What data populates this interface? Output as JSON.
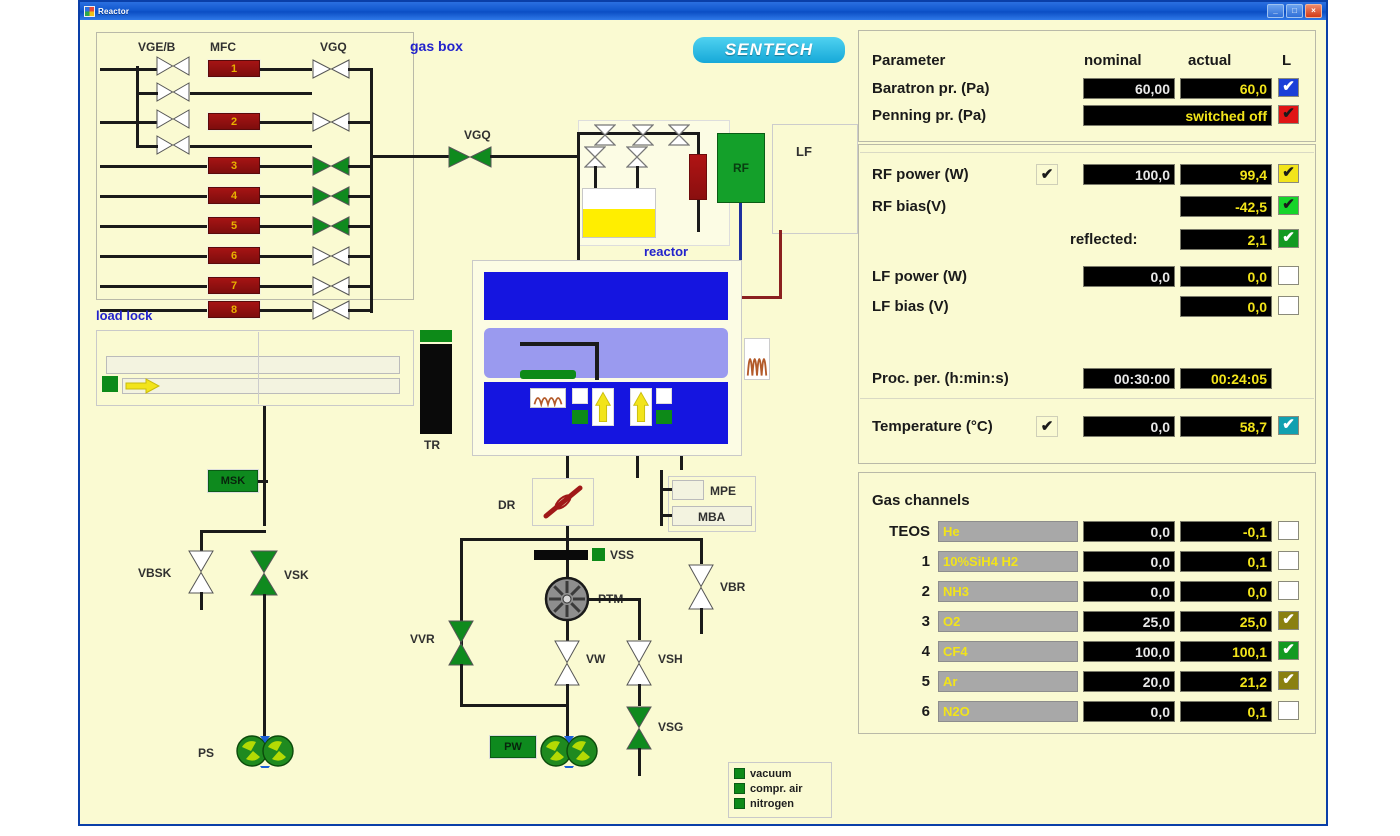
{
  "window": {
    "title": "Reactor",
    "minimize": "_",
    "maximize": "□",
    "close": "×"
  },
  "brand": {
    "logo": "SENTECH"
  },
  "diagram": {
    "gas_box_label": "gas box",
    "reactor_label": "reactor",
    "load_lock_label": "load lock",
    "column_headers": {
      "vge": "VGE/B",
      "mfc": "MFC",
      "vgq": "VGQ"
    },
    "mfc_channels": [
      "1",
      "2",
      "3",
      "4",
      "5",
      "6",
      "7",
      "8"
    ],
    "vgq_inline_label": "VGQ",
    "rf_generator": "RF",
    "lf_generator": "LF",
    "transfer": "TR",
    "msk": "MSK",
    "vbsk": "VBSK",
    "vsk": "VSK",
    "ps_pump": "PS",
    "dr_valve": "DR",
    "vss": "VSS",
    "ptm": "PTM",
    "vbr": "VBR",
    "vvr": "VVR",
    "vw": "VW",
    "vsh": "VSH",
    "vsg": "VSG",
    "pw_pump": "PW",
    "mpe": "MPE",
    "mba": "MBA",
    "legend": [
      {
        "label": "vacuum",
        "color": "#0d8a18"
      },
      {
        "label": "compr. air",
        "color": "#0d8a18"
      },
      {
        "label": "nitrogen",
        "color": "#0d8a18"
      }
    ]
  },
  "parameters": {
    "headers": {
      "name": "Parameter",
      "nominal": "nominal",
      "actual": "actual",
      "lock": "L"
    },
    "rows": [
      {
        "label": "Baratron pr. (Pa)",
        "nominal": "60,00",
        "actual": "60,0",
        "checkbox": "checked",
        "checkbox_color": "#1a3fd8",
        "tick_color": "#ffffff",
        "has_pre_check": false
      },
      {
        "label": "Penning pr. (Pa)",
        "nominal": "",
        "actual": "switched off",
        "checkbox": "checked",
        "checkbox_color": "#e01414",
        "tick_color": "#1a1a1a",
        "has_pre_check": false
      }
    ]
  },
  "power": {
    "reflected_label": "reflected:",
    "rows": [
      {
        "label": "RF power (W)",
        "nominal": "100,0",
        "actual": "99,4",
        "checkbox": "checked",
        "checkbox_color": "#f2e41a",
        "tick_color": "#1a1a1a",
        "has_pre_check": true
      },
      {
        "label": "RF bias(V)",
        "nominal": "",
        "actual": "-42,5",
        "checkbox": "checked",
        "checkbox_color": "#16d42a",
        "tick_color": "#1a1a1a",
        "has_pre_check": false
      },
      {
        "label": "",
        "nominal": "reflected:",
        "actual": "2,1",
        "checkbox": "checked",
        "checkbox_color": "#139a22",
        "tick_color": "#ffffff",
        "has_pre_check": false
      },
      {
        "label": "LF power (W)",
        "nominal": "0,0",
        "actual": "0,0",
        "checkbox": "unchecked",
        "checkbox_color": "#ffffff",
        "tick_color": "#ffffff",
        "has_pre_check": false
      },
      {
        "label": "LF bias (V)",
        "nominal": "",
        "actual": "0,0",
        "checkbox": "unchecked",
        "checkbox_color": "#ffffff",
        "tick_color": "#ffffff",
        "has_pre_check": false
      }
    ]
  },
  "process": {
    "period": {
      "label": "Proc. per. (h:min:s)",
      "nominal": "00:30:00",
      "actual": "00:24:05"
    },
    "temperature": {
      "label": "Temperature (°C)",
      "nominal": "0,0",
      "actual": "58,7",
      "checkbox": "checked",
      "checkbox_color": "#11a0b0",
      "tick_color": "#ffffff",
      "has_pre_check": true
    }
  },
  "gas": {
    "title": "Gas channels",
    "rows": [
      {
        "channel": "TEOS",
        "name": "He",
        "nominal": "0,0",
        "actual": "-0,1",
        "checkbox": "unchecked",
        "checkbox_color": "#ffffff",
        "tick_color": "#ffffff"
      },
      {
        "channel": "1",
        "name": "10%SiH4 H2",
        "nominal": "0,0",
        "actual": "0,1",
        "checkbox": "unchecked",
        "checkbox_color": "#ffffff",
        "tick_color": "#ffffff"
      },
      {
        "channel": "2",
        "name": "NH3",
        "nominal": "0,0",
        "actual": "0,0",
        "checkbox": "unchecked",
        "checkbox_color": "#ffffff",
        "tick_color": "#ffffff"
      },
      {
        "channel": "3",
        "name": "O2",
        "nominal": "25,0",
        "actual": "25,0",
        "checkbox": "checked",
        "checkbox_color": "#8a8010",
        "tick_color": "#ffffff"
      },
      {
        "channel": "4",
        "name": "CF4",
        "nominal": "100,0",
        "actual": "100,1",
        "checkbox": "checked",
        "checkbox_color": "#139a22",
        "tick_color": "#ffffff"
      },
      {
        "channel": "5",
        "name": "Ar",
        "nominal": "20,0",
        "actual": "21,2",
        "checkbox": "checked",
        "checkbox_color": "#8a8010",
        "tick_color": "#ffffff"
      },
      {
        "channel": "6",
        "name": "N2O",
        "nominal": "0,0",
        "actual": "0,1",
        "checkbox": "unchecked",
        "checkbox_color": "#ffffff",
        "tick_color": "#ffffff"
      }
    ]
  },
  "colors": {
    "app_bg": "#fafad2",
    "valve_open": "#0f8a1e",
    "valve_closed": "#ffffff",
    "pipe": "#1a1a1a",
    "accent_blue": "#2222cc"
  }
}
